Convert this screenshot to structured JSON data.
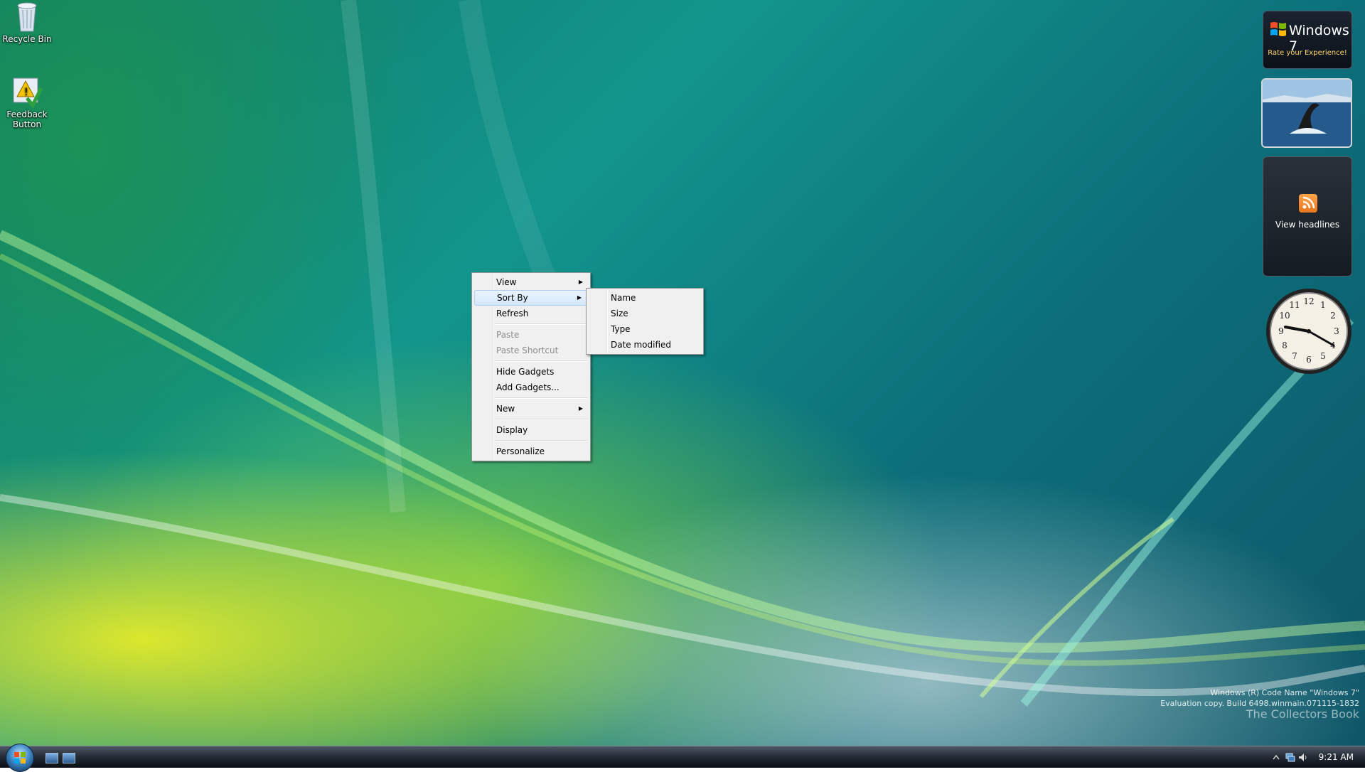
{
  "desktop_icons": [
    {
      "label": "Recycle Bin",
      "icon": "recycle-bin-icon"
    },
    {
      "label": "Feedback Button",
      "icon": "feedback-icon"
    }
  ],
  "gadgets": {
    "win7": {
      "title": "Windows 7",
      "subtitle": "Rate your Experience!"
    },
    "feed": {
      "label": "View headlines",
      "icon": "rss-icon"
    },
    "clock": {
      "numbers": [
        "12",
        "1",
        "2",
        "3",
        "4",
        "5",
        "6",
        "7",
        "8",
        "9",
        "10",
        "11"
      ]
    }
  },
  "context_menu": {
    "items": [
      {
        "label": "View",
        "submenu": true,
        "enabled": true
      },
      {
        "label": "Sort By",
        "submenu": true,
        "enabled": true,
        "highlighted": true
      },
      {
        "label": "Refresh",
        "enabled": true
      },
      {
        "label": "Paste",
        "enabled": false
      },
      {
        "label": "Paste Shortcut",
        "enabled": false
      },
      {
        "label": "Hide Gadgets",
        "enabled": true
      },
      {
        "label": "Add Gadgets...",
        "enabled": true
      },
      {
        "label": "New",
        "submenu": true,
        "enabled": true
      },
      {
        "label": "Display",
        "enabled": true
      },
      {
        "label": "Personalize",
        "enabled": true
      }
    ],
    "sort_by": [
      "Name",
      "Size",
      "Type",
      "Date modified"
    ]
  },
  "watermark": {
    "line1": "Windows (R) Code Name \"Windows 7\"",
    "line2": "Evaluation copy. Build 6498.winmain.071115-1832",
    "line3": "The Collectors Book"
  },
  "taskbar": {
    "clock": "9:21 AM"
  },
  "colors": {
    "menu_highlight": "#d6e8fb",
    "taskbar": "#1c232c",
    "gadget_accent": "#ffd36a"
  }
}
